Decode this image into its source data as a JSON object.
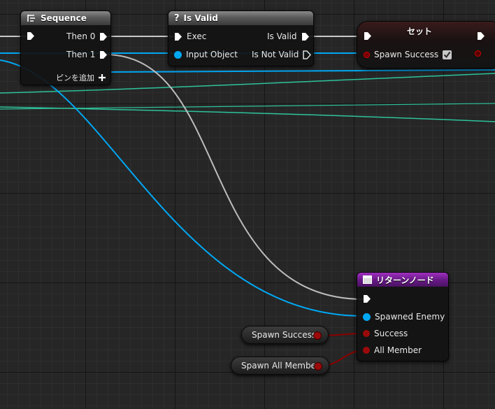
{
  "sequence": {
    "title": "Sequence",
    "then0": "Then 0",
    "then1": "Then 1",
    "add_pin": "ピンを追加",
    "icon": "sequence-icon"
  },
  "isvalid": {
    "title": "Is Valid",
    "exec": "Exec",
    "input_object": "Input Object",
    "is_valid": "Is Valid",
    "is_not_valid": "Is Not Valid",
    "icon": "question-icon"
  },
  "set": {
    "title": "セット",
    "spawn_success": "Spawn Success",
    "checked": true
  },
  "return": {
    "title": "リターンノード",
    "spawned_enemy": "Spawned Enemy",
    "success": "Success",
    "all_member": "All Member",
    "icon": "return-node-icon"
  },
  "vars": {
    "spawn_success": "Spawn Success",
    "spawn_all_member": "Spawn All Member"
  },
  "colors": {
    "object_pin": "#00a8f4",
    "bool_pin": "#950000",
    "exec_wire": "#c8c8c8",
    "teal_wire": "#2ac79a"
  }
}
